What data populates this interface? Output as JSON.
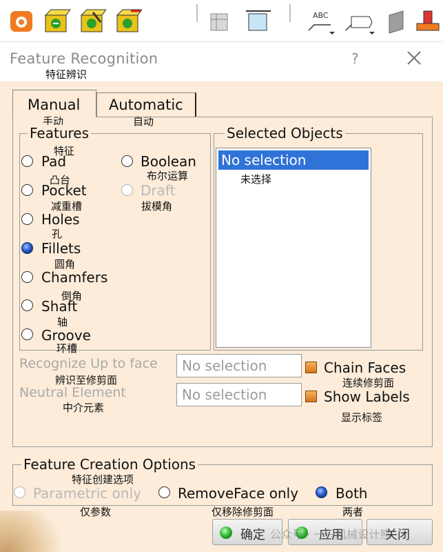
{
  "toolbar": {
    "icons": [
      "sketch-icon",
      "update-icon",
      "analyze-icon",
      "replace-icon",
      "text-abc-icon",
      "annotation-flag-icon",
      "measure-icon",
      "stamp-icon"
    ],
    "text_icon_label": "ABC"
  },
  "dialog": {
    "title": "Feature Recognition",
    "title_cn": "特征辨识",
    "help": "?",
    "tabs": [
      {
        "label": "Manual",
        "cn": "手动"
      },
      {
        "label": "Automatic",
        "cn": "自动"
      }
    ],
    "features": {
      "title": "Features",
      "title_cn": "特征",
      "options": [
        {
          "label": "Pad",
          "cn": "凸台"
        },
        {
          "label": "Pocket",
          "cn": "减重槽"
        },
        {
          "label": "Holes",
          "cn": "孔"
        },
        {
          "label": "Fillets",
          "cn": "圆角"
        },
        {
          "label": "Chamfers",
          "cn": "倒角"
        },
        {
          "label": "Shaft",
          "cn": "轴"
        },
        {
          "label": "Groove",
          "cn": "环槽"
        },
        {
          "label": "Boolean",
          "cn": "布尔运算"
        },
        {
          "label": "Draft",
          "cn": "拔模角"
        }
      ],
      "selected": "Fillets"
    },
    "selected_objects": {
      "title": "Selected Objects",
      "item": "No selection",
      "item_cn": "未选择"
    },
    "recognize_up_to_face": {
      "label": "Recognize Up to face",
      "cn": "辨识至修剪面",
      "value": "No selection"
    },
    "neutral_element": {
      "label": "Neutral Element",
      "cn": "中介元素",
      "value": "No selection"
    },
    "chain_faces": {
      "label": "Chain Faces",
      "cn": "连续修剪面",
      "checked": true
    },
    "show_labels": {
      "label": "Show Labels",
      "cn": "显示标签",
      "checked": true
    },
    "creation_options": {
      "title": "Feature Creation Options",
      "title_cn": "特征创建选项",
      "options": [
        {
          "label": "Parametric only",
          "cn": "仅参数"
        },
        {
          "label": "RemoveFace only",
          "cn": "仅移除修剪面"
        },
        {
          "label": "Both",
          "cn": "两者"
        }
      ],
      "selected": "Both"
    },
    "buttons": {
      "ok": "确定",
      "apply": "应用",
      "close": "关闭"
    },
    "watermark": "公众号 · 一只机械设计熊"
  },
  "colors": {
    "background": "#fcecd9",
    "selection": "#2f73d8",
    "checkbox": "#e08a2a",
    "disabled_text": "#b9b9b9"
  }
}
